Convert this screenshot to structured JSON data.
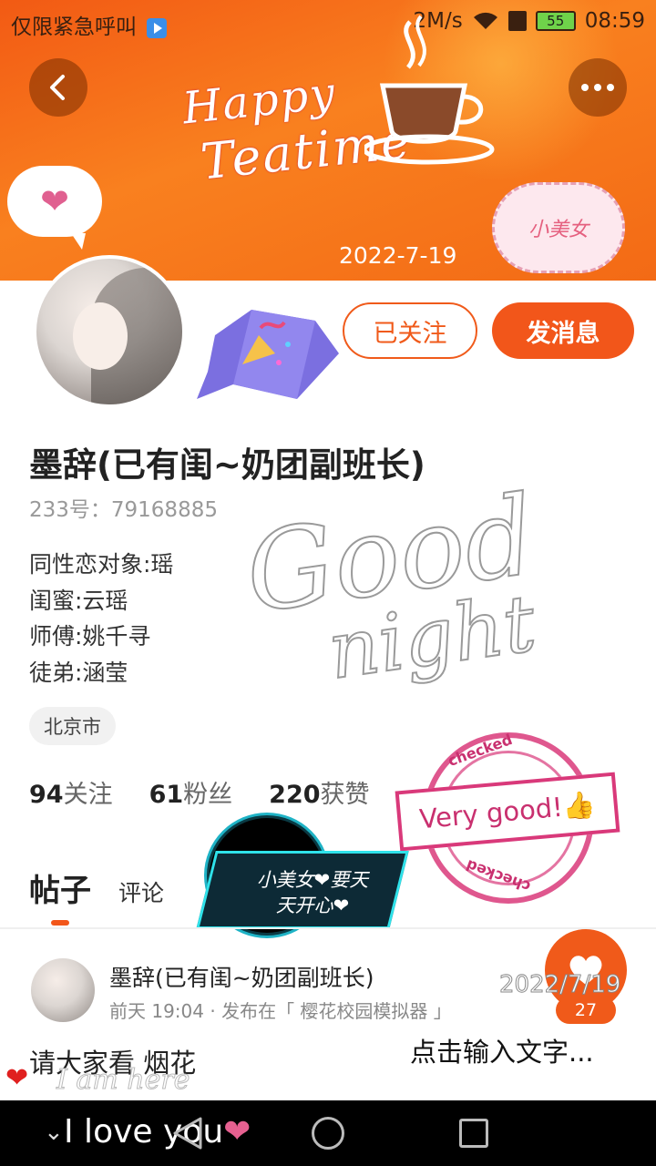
{
  "status_bar": {
    "carrier_text": "仅限紧急呼叫",
    "network_speed": "2M/s",
    "battery": "55",
    "time": "08:59"
  },
  "banner": {
    "line1": "Happy",
    "line2": "Teatime",
    "date": "2022-7-19",
    "cloud_tag": "小美女",
    "heart_bubble": "❤"
  },
  "profile": {
    "name": "墨辞(已有闺~奶团副班长)",
    "uid": "233号：79168885",
    "bio": [
      "同性恋对象:瑶",
      "闺蜜:云瑶",
      "师傅:姚千寻",
      "徒弟:涵莹"
    ],
    "city": "北京市",
    "follow_label": "已关注",
    "message_label": "发消息"
  },
  "stats": {
    "following_count": "94",
    "following_label": "关注",
    "fans_count": "61",
    "fans_label": "粉丝",
    "likes_count": "220",
    "likes_label": "获赞"
  },
  "stickers": {
    "good": "Good",
    "night": "night",
    "stamp_text": "Very good!👍",
    "stamp_small": "checked",
    "neon_text_1": "小美女❤要天",
    "neon_text_2": "天开心❤"
  },
  "tabs": {
    "posts": "帖子",
    "comments": "评论"
  },
  "post": {
    "author": "墨辞(已有闺~奶团副班长)",
    "meta": "前天 19:04 · 发布在「 樱花校园模拟器 」",
    "text": "请大家看 烟花",
    "like_count": "27"
  },
  "overlays": {
    "date": "2022/7/19",
    "input_hint": "点击输入文字...",
    "iamhere": "I am here"
  },
  "navbar": {
    "love_text": "I love you",
    "love_heart": "❤"
  }
}
